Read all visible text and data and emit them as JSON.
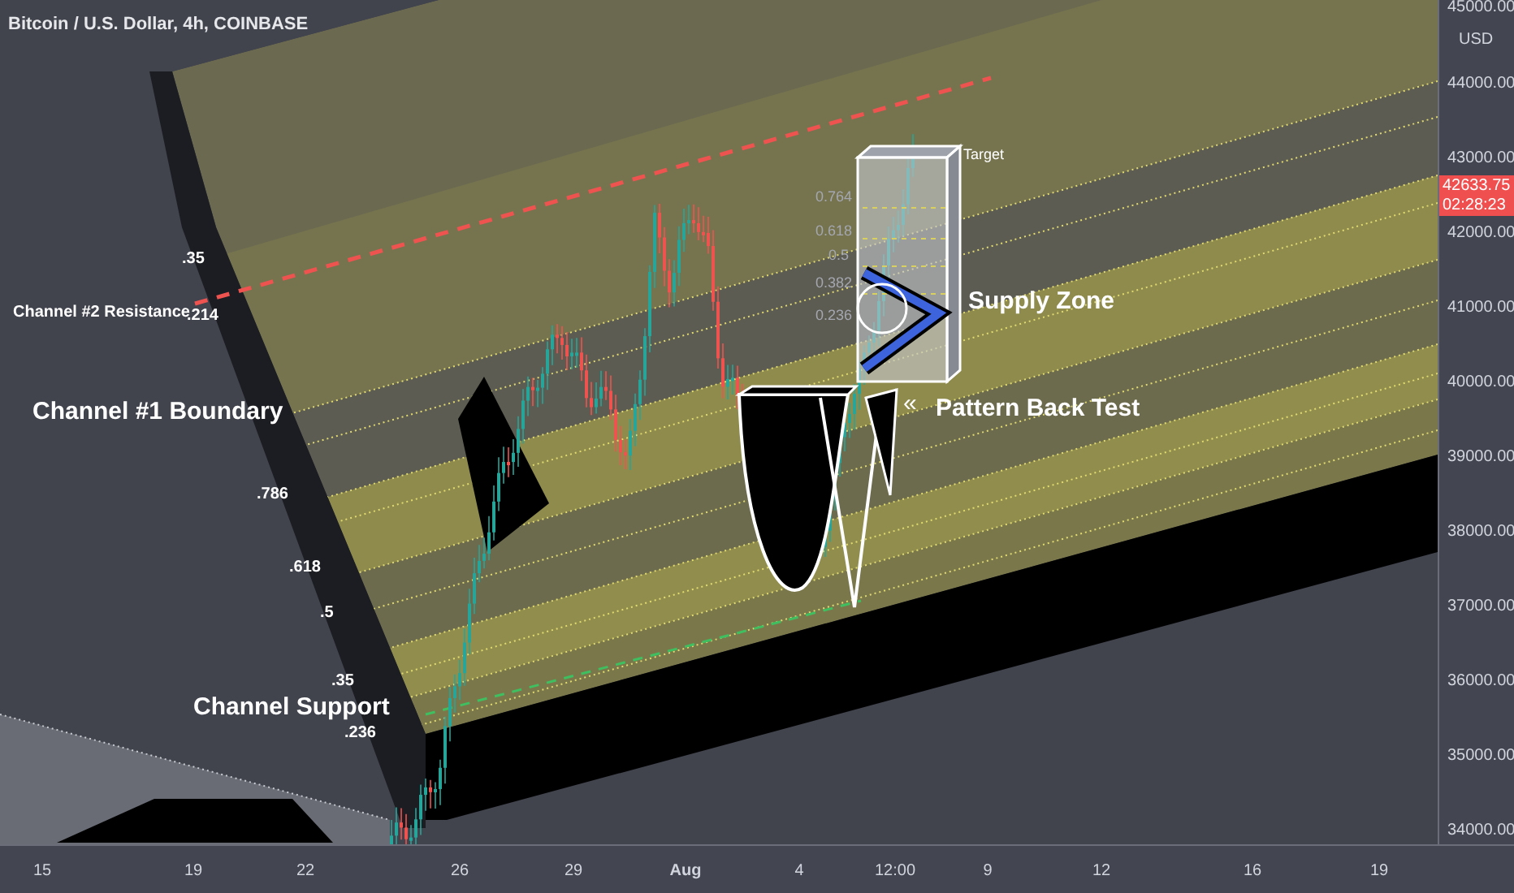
{
  "title": "Bitcoin / U.S. Dollar, 4h, COINBASE",
  "annotations": [
    {
      "text": ".35",
      "kind": "ratio"
    },
    {
      "text": "Channel #2 Resistance",
      "kind": "note"
    },
    {
      "text": ".214",
      "kind": "ratio"
    },
    {
      "text": "Channel #1 Boundary",
      "kind": "heading"
    },
    {
      "text": ".786",
      "kind": "ratio"
    },
    {
      "text": ".618",
      "kind": "ratio"
    },
    {
      "text": ".5",
      "kind": "ratio"
    },
    {
      "text": ".35",
      "kind": "ratio"
    },
    {
      "text": "Channel Support",
      "kind": "heading"
    },
    {
      "text": ".236",
      "kind": "ratio"
    },
    {
      "text": "Target",
      "kind": "tag"
    },
    {
      "text": "0.764",
      "kind": "fib"
    },
    {
      "text": "0.618",
      "kind": "fib"
    },
    {
      "text": "0.5",
      "kind": "fib"
    },
    {
      "text": "0.382",
      "kind": "fib"
    },
    {
      "text": "0.236",
      "kind": "fib"
    },
    {
      "text": "Supply Zone",
      "kind": "heading"
    },
    {
      "text": "«",
      "kind": "glyph"
    },
    {
      "text": "Pattern Back Test",
      "kind": "heading"
    }
  ],
  "price_axis": {
    "currency": "USD",
    "labels": [
      "45000.00",
      "44000.00",
      "43000.00",
      "42000.00",
      "41000.00",
      "40000.00",
      "39000.00",
      "38000.00",
      "37000.00",
      "36000.00",
      "35000.00",
      "34000.00"
    ],
    "last_price": {
      "value": "42633.75",
      "countdown": "02:28:23"
    }
  },
  "time_axis": [
    {
      "label": "15",
      "kind": "day"
    },
    {
      "label": "19",
      "kind": "day"
    },
    {
      "label": "22",
      "kind": "day"
    },
    {
      "label": "26",
      "kind": "day"
    },
    {
      "label": "29",
      "kind": "day"
    },
    {
      "label": "Aug",
      "kind": "month"
    },
    {
      "label": "4",
      "kind": "day"
    },
    {
      "label": "12:00",
      "kind": "day"
    },
    {
      "label": "9",
      "kind": "day"
    },
    {
      "label": "12",
      "kind": "day"
    },
    {
      "label": "16",
      "kind": "day"
    },
    {
      "label": "19",
      "kind": "day"
    }
  ]
}
